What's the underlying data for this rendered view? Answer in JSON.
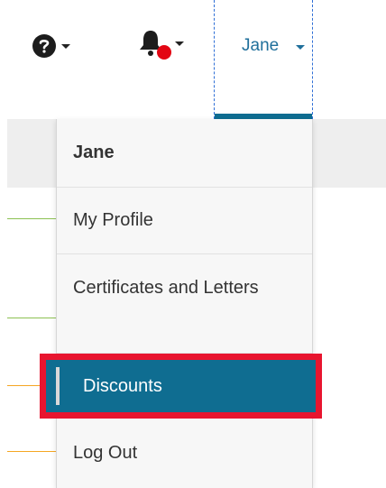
{
  "nav": {
    "help_icon": "question-circle-icon",
    "bell_icon": "bell-icon",
    "user_label": "Jane"
  },
  "dropdown": {
    "header": "Jane",
    "items": [
      {
        "label": "My Profile"
      },
      {
        "label": "Certificates and Letters"
      },
      {
        "label": "Discounts",
        "selected": true
      },
      {
        "label": "Log Out"
      }
    ]
  },
  "colors": {
    "accent": "#0f6d91",
    "highlight_outline": "#e8152f",
    "notification_badge": "#e30613",
    "line_green": "#8cc152",
    "line_orange": "#f5a623"
  }
}
